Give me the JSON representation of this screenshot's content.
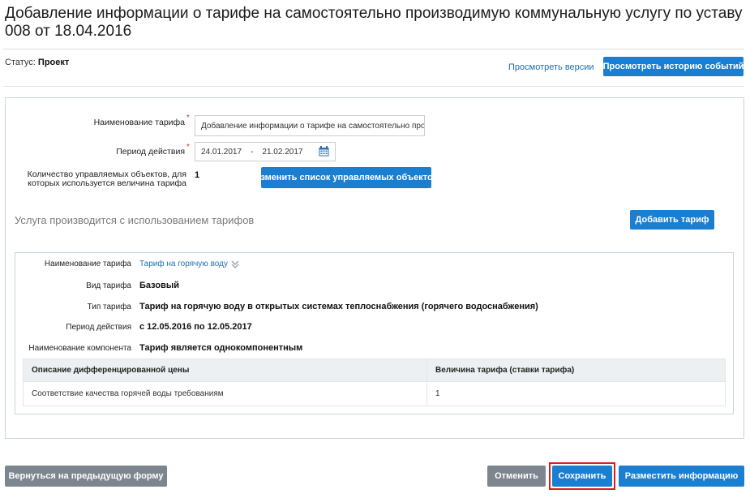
{
  "page": {
    "title": "Добавление информации о тарифе на самостоятельно производимую коммунальную услугу по уставу 008 от 18.04.2016"
  },
  "status": {
    "label": "Статус:",
    "value": "Проект"
  },
  "header_actions": {
    "versions_link": "Просмотреть версии",
    "history_button": "Просмотреть историю событий"
  },
  "form": {
    "tariff_name_label": "Наименование тарифа",
    "tariff_name_value": "Добавление информации о тарифе на самостоятельно производимую коммунальную услугу",
    "period_label": "Период действия",
    "period_from": "24.01.2017",
    "period_sep": "-",
    "period_to": "21.02.2017",
    "count_label": "Количество управляемых объектов, для которых используется величина тарифа",
    "count_value": "1",
    "change_button": "Изменить список управляемых объектов",
    "required_mark": "*"
  },
  "section": {
    "title": "Услуга производится с использованием тарифов",
    "add_button": "Добавить тариф"
  },
  "tariff": {
    "name_label": "Наименование тарифа",
    "name_link": "Тариф на горячую воду",
    "type_label": "Вид тарифа",
    "type_value": "Базовый",
    "kind_label": "Тип тарифа",
    "kind_value": "Тариф на горячую воду в открытых системах теплоснабжения (горячего водоснабжения)",
    "period_label": "Период действия",
    "period_value": "с 12.05.2016 по 12.05.2017",
    "component_label": "Наименование компонента",
    "component_value": "Тариф является однокомпонентным",
    "table": {
      "headers": [
        "Описание дифференцированной цены",
        "Величина тарифа (ставки тарифа)"
      ],
      "rows": [
        [
          "Соответствие качества горячей воды требованиям",
          "1"
        ]
      ]
    }
  },
  "footer": {
    "back_button": "Вернуться на предыдущую форму",
    "cancel_button": "Отменить",
    "save_button": "Сохранить",
    "place_button": "Разместить информацию"
  },
  "colors": {
    "primary": "#1b7fd1",
    "secondary": "#7d868e",
    "highlight": "#e01b1b",
    "link": "#1f6fb5"
  },
  "icons": {
    "calendar": "calendar-icon",
    "expand": "chevron-double-down-icon"
  }
}
